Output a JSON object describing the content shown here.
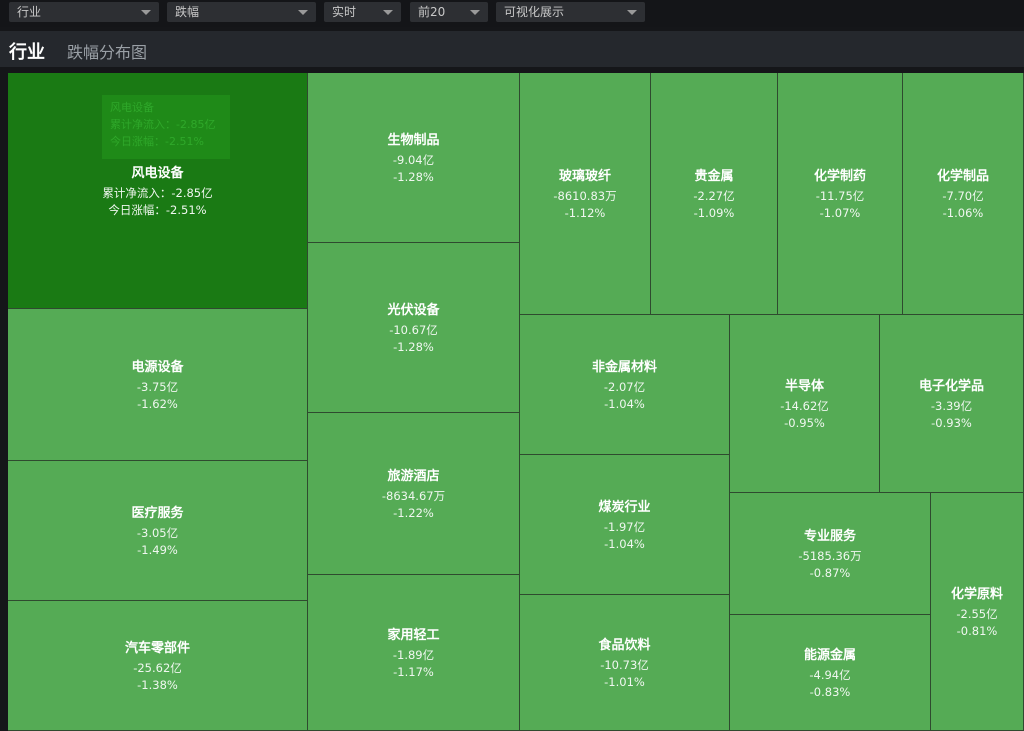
{
  "filters": [
    {
      "label": "行业"
    },
    {
      "label": "跌幅"
    },
    {
      "label": "实时"
    },
    {
      "label": "前20"
    },
    {
      "label": "可视化展示"
    }
  ],
  "header": {
    "title": "行业",
    "subtitle": "跌幅分布图"
  },
  "tooltip": {
    "name": "风电设备",
    "line1": "累计净流入：-2.85亿",
    "line2": "今日涨幅：-2.51%"
  },
  "tiles": [
    {
      "name": "风电设备",
      "v1": "累计净流入：-2.85亿",
      "v2": "今日涨幅：-2.51%"
    },
    {
      "name": "电源设备",
      "v1": "-3.75亿",
      "v2": "-1.62%"
    },
    {
      "name": "医疗服务",
      "v1": "-3.05亿",
      "v2": "-1.49%"
    },
    {
      "name": "汽车零部件",
      "v1": "-25.62亿",
      "v2": "-1.38%"
    },
    {
      "name": "生物制品",
      "v1": "-9.04亿",
      "v2": "-1.28%"
    },
    {
      "name": "光伏设备",
      "v1": "-10.67亿",
      "v2": "-1.28%"
    },
    {
      "name": "旅游酒店",
      "v1": "-8634.67万",
      "v2": "-1.22%"
    },
    {
      "name": "家用轻工",
      "v1": "-1.89亿",
      "v2": "-1.17%"
    },
    {
      "name": "玻璃玻纤",
      "v1": "-8610.83万",
      "v2": "-1.12%"
    },
    {
      "name": "贵金属",
      "v1": "-2.27亿",
      "v2": "-1.09%"
    },
    {
      "name": "化学制药",
      "v1": "-11.75亿",
      "v2": "-1.07%"
    },
    {
      "name": "化学制品",
      "v1": "-7.70亿",
      "v2": "-1.06%"
    },
    {
      "name": "非金属材料",
      "v1": "-2.07亿",
      "v2": "-1.04%"
    },
    {
      "name": "煤炭行业",
      "v1": "-1.97亿",
      "v2": "-1.04%"
    },
    {
      "name": "食品饮料",
      "v1": "-10.73亿",
      "v2": "-1.01%"
    },
    {
      "name": "半导体",
      "v1": "-14.62亿",
      "v2": "-0.95%"
    },
    {
      "name": "电子化学品",
      "v1": "-3.39亿",
      "v2": "-0.93%"
    },
    {
      "name": "专业服务",
      "v1": "-5185.36万",
      "v2": "-0.87%"
    },
    {
      "name": "能源金属",
      "v1": "-4.94亿",
      "v2": "-0.83%"
    },
    {
      "name": "化学原料",
      "v1": "-2.55亿",
      "v2": "-0.81%"
    }
  ],
  "colors": {
    "tile": "#55ab55",
    "tile_highlight": "#1a7a14",
    "border": "#2f4a2f",
    "background": "#151619"
  }
}
